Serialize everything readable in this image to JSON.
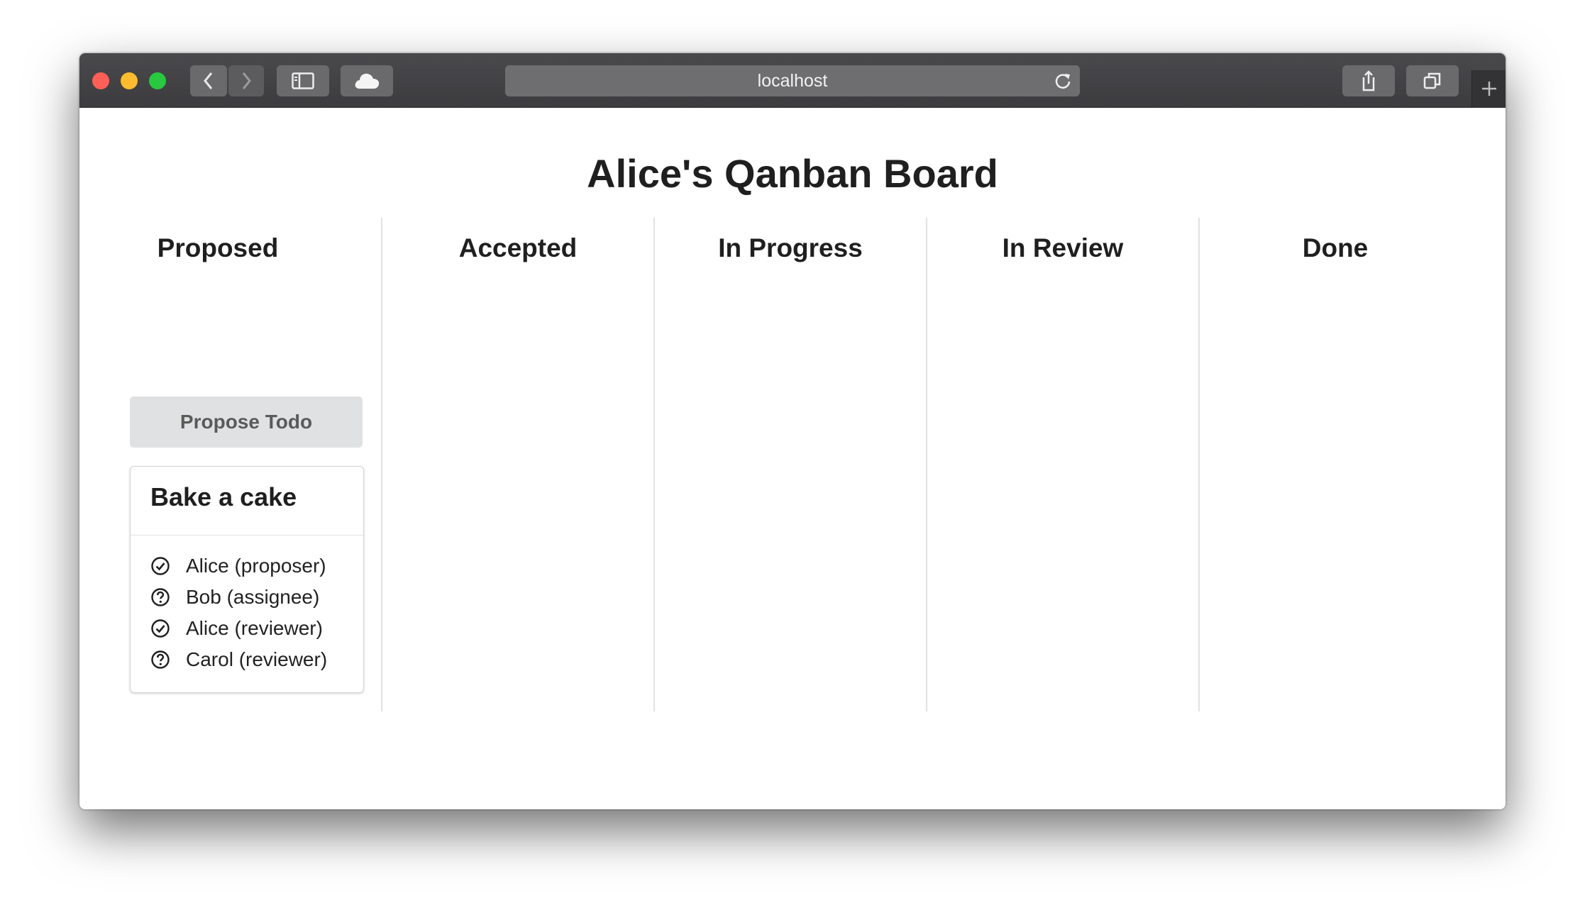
{
  "browser": {
    "url": "localhost"
  },
  "page": {
    "title": "Alice's Qanban Board"
  },
  "columns": [
    {
      "title": "Proposed"
    },
    {
      "title": "Accepted"
    },
    {
      "title": "In Progress"
    },
    {
      "title": "In Review"
    },
    {
      "title": "Done"
    }
  ],
  "propose_button": {
    "label": "Propose Todo"
  },
  "cards": [
    {
      "title": "Bake a cake",
      "participants": [
        {
          "label": "Alice (proposer)",
          "status": "approved",
          "icon": "check-circle-icon"
        },
        {
          "label": "Bob (assignee)",
          "status": "pending",
          "icon": "question-circle-icon"
        },
        {
          "label": "Alice (reviewer)",
          "status": "approved",
          "icon": "check-circle-icon"
        },
        {
          "label": "Carol (reviewer)",
          "status": "pending",
          "icon": "question-circle-icon"
        }
      ]
    }
  ],
  "colors": {
    "close": "#fe5f57",
    "minimize": "#febc2e",
    "zoom": "#28c840",
    "titlebar": "#3f3e41",
    "button_gray": "#e0e1e2"
  }
}
